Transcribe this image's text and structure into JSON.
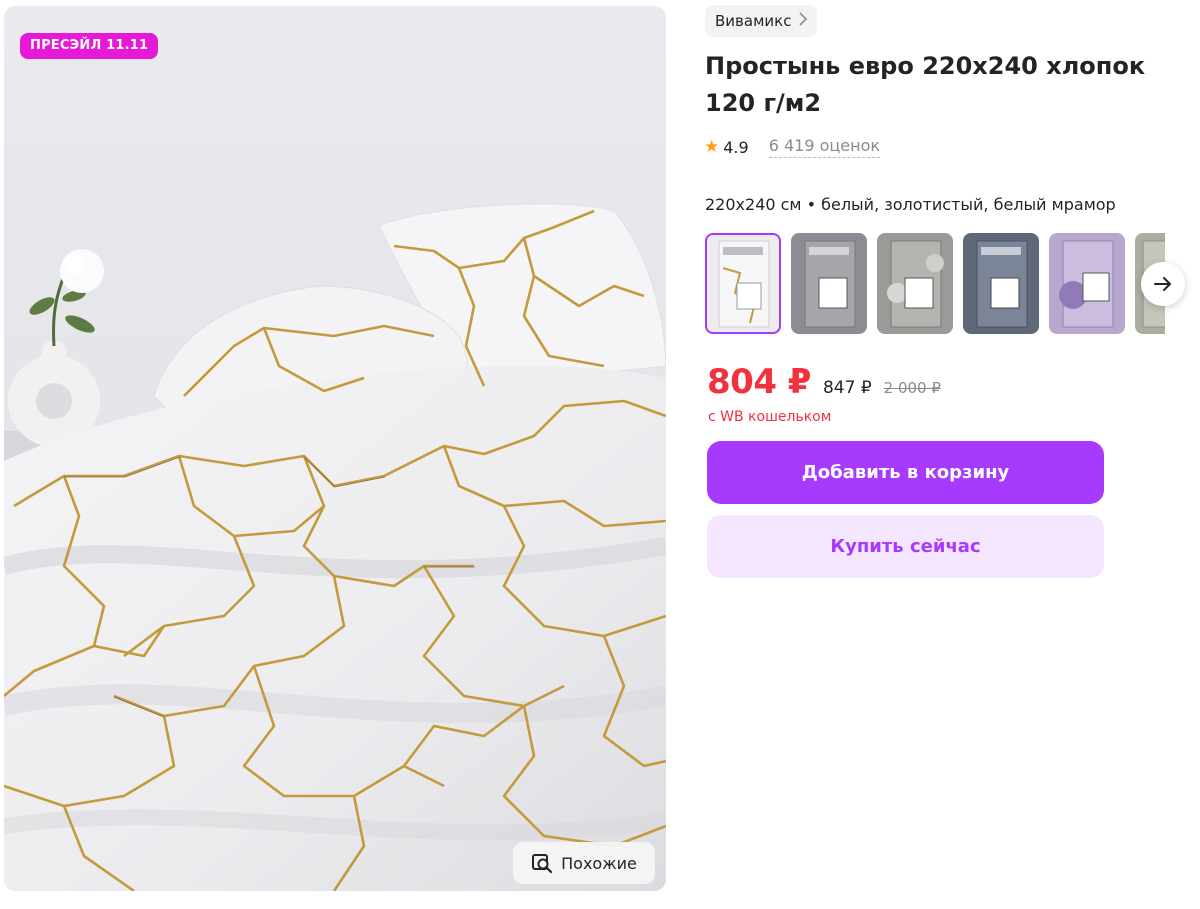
{
  "product": {
    "promo_badge": "ПРЕСЭЙЛ 11.11",
    "brand": "Вивамикс",
    "title": "Простынь евро 220x240 хлопок 120 г/м2",
    "rating": "4.9",
    "reviews": "6 419 оценок",
    "variant": "220x240 см • белый, золотистый, белый мрамор"
  },
  "gallery": {
    "similar_label": "Похожие",
    "thumbnails": [
      {
        "name": "white-gold-marble",
        "selected": true
      },
      {
        "name": "grey-set"
      },
      {
        "name": "cats-grey"
      },
      {
        "name": "blue-grey"
      },
      {
        "name": "purple-cats"
      },
      {
        "name": "green-partial"
      }
    ]
  },
  "price": {
    "current": "804 ₽",
    "alt": "847 ₽",
    "old": "2 000 ₽",
    "note": "с WB кошельком"
  },
  "actions": {
    "add_to_cart": "Добавить в корзину",
    "buy_now": "Купить сейчас"
  },
  "colors": {
    "accent": "#a73afd",
    "price_red": "#f2313e",
    "badge_pink": "#e61ad6",
    "buy_bg": "#f5e6ff"
  }
}
